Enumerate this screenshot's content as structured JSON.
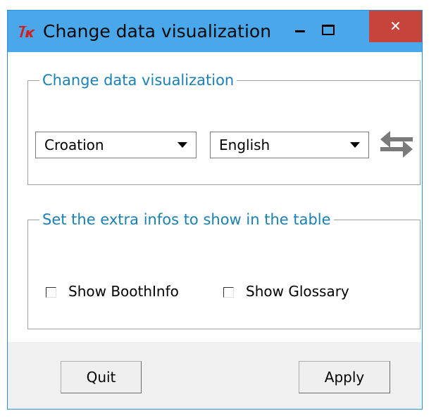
{
  "window": {
    "title": "Change data visualization",
    "close_glyph": "✕",
    "app_icon": "tk-feather-icon"
  },
  "visualization_group": {
    "title": "Change data visualization",
    "source_language": "Croation",
    "target_language": "English",
    "swap_icon": "swap-arrows-icon"
  },
  "extra_info_group": {
    "title": "Set the extra infos to show in the table",
    "checkboxes": [
      {
        "label": "Show BoothInfo",
        "checked": false
      },
      {
        "label": "Show Glossary",
        "checked": false
      }
    ]
  },
  "footer": {
    "quit_label": "Quit",
    "apply_label": "Apply"
  },
  "colors": {
    "titlebar": "#4aa7ea",
    "close_button": "#c7443c",
    "group_title": "#1a80b5",
    "swap_arrows": "#7a7a7a"
  }
}
